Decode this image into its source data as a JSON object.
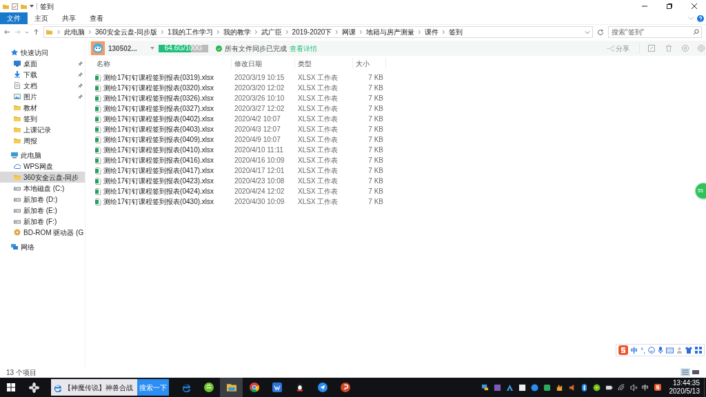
{
  "window": {
    "title": "签到"
  },
  "ribbon_tabs": [
    {
      "label": "文件",
      "selected": true
    },
    {
      "label": "主页",
      "selected": false
    },
    {
      "label": "共享",
      "selected": false
    },
    {
      "label": "查看",
      "selected": false
    }
  ],
  "breadcrumb": [
    "此电脑",
    "360安全云盘-同步版",
    "1我的工作学习",
    "我的教学",
    "武广臣",
    "2019-2020下",
    "网课",
    "地籍与房产测量",
    "课件",
    "签到"
  ],
  "search": {
    "placeholder": "搜索\"签到\""
  },
  "sidebar": [
    {
      "label": "快速访问",
      "kind": "star",
      "selected": false,
      "children": [
        {
          "label": "桌面",
          "kind": "desktop",
          "pinned": true,
          "selected": false
        },
        {
          "label": "下载",
          "kind": "download",
          "pinned": true,
          "selected": false
        },
        {
          "label": "文档",
          "kind": "document",
          "pinned": true,
          "selected": false
        },
        {
          "label": "图片",
          "kind": "image",
          "pinned": true,
          "selected": false
        },
        {
          "label": "教材",
          "kind": "folder",
          "pinned": false,
          "selected": false
        },
        {
          "label": "签到",
          "kind": "folder",
          "pinned": false,
          "selected": false
        },
        {
          "label": "上课记录",
          "kind": "folder",
          "pinned": false,
          "selected": false
        },
        {
          "label": "周报",
          "kind": "folder",
          "pinned": false,
          "selected": false
        }
      ]
    },
    {
      "label": "此电脑",
      "kind": "pc",
      "selected": false,
      "children": [
        {
          "label": "WPS网盘",
          "kind": "cloud",
          "pinned": false,
          "selected": false
        },
        {
          "label": "360安全云盘-同步",
          "kind": "folder",
          "pinned": false,
          "selected": true
        },
        {
          "label": "本地磁盘 (C:)",
          "kind": "drive",
          "pinned": false,
          "selected": false
        },
        {
          "label": "新加卷 (D:)",
          "kind": "drive",
          "pinned": false,
          "selected": false
        },
        {
          "label": "新加卷 (E:)",
          "kind": "drive",
          "pinned": false,
          "selected": false
        },
        {
          "label": "新加卷 (F:)",
          "kind": "drive",
          "pinned": false,
          "selected": false
        },
        {
          "label": "BD-ROM 驱动器 (G",
          "kind": "disc",
          "pinned": false,
          "selected": false
        }
      ]
    },
    {
      "label": "网络",
      "kind": "network",
      "selected": false
    }
  ],
  "sync_bar": {
    "account": "130502...",
    "storage": {
      "reading": "64.6G/100G",
      "level": 0.646
    },
    "status": "所有文件同步已完成",
    "details_link": "查看详情",
    "share": {
      "label": "分享",
      "disabled": true
    }
  },
  "table": {
    "columns": [
      "名称",
      "修改日期",
      "类型",
      "大小"
    ],
    "rows": [
      [
        "测绘17钉钉课程签到报表(0319).xlsx",
        "2020/3/19 10:15",
        "XLSX 工作表",
        "7 KB"
      ],
      [
        "测绘17钉钉课程签到报表(0320).xlsx",
        "2020/3/20 12:02",
        "XLSX 工作表",
        "7 KB"
      ],
      [
        "测绘17钉钉课程签到报表(0326).xlsx",
        "2020/3/26 10:10",
        "XLSX 工作表",
        "7 KB"
      ],
      [
        "测绘17钉钉课程签到报表(0327).xlsx",
        "2020/3/27 12:02",
        "XLSX 工作表",
        "7 KB"
      ],
      [
        "测绘17钉钉课程签到报表(0402).xlsx",
        "2020/4/2 10:07",
        "XLSX 工作表",
        "7 KB"
      ],
      [
        "测绘17钉钉课程签到报表(0403).xlsx",
        "2020/4/3 12:07",
        "XLSX 工作表",
        "7 KB"
      ],
      [
        "测绘17钉钉课程签到报表(0409).xlsx",
        "2020/4/9 10:07",
        "XLSX 工作表",
        "7 KB"
      ],
      [
        "测绘17钉钉课程签到报表(0410).xlsx",
        "2020/4/10 11:11",
        "XLSX 工作表",
        "7 KB"
      ],
      [
        "测绘17钉钉课程签到报表(0416).xlsx",
        "2020/4/16 10:09",
        "XLSX 工作表",
        "7 KB"
      ],
      [
        "测绘17钉钉课程签到报表(0417).xlsx",
        "2020/4/17 12:01",
        "XLSX 工作表",
        "7 KB"
      ],
      [
        "测绘17钉钉课程签到报表(0423).xlsx",
        "2020/4/23 10:08",
        "XLSX 工作表",
        "7 KB"
      ],
      [
        "测绘17钉钉课程签到报表(0424).xlsx",
        "2020/4/24 12:02",
        "XLSX 工作表",
        "7 KB"
      ],
      [
        "测绘17钉钉课程签到报表(0430).xlsx",
        "2020/4/30 10:09",
        "XLSX 工作表",
        "7 KB"
      ]
    ]
  },
  "floating_ball": "55",
  "ime_toolbar": {
    "mode": "中",
    "punct": "°,"
  },
  "status_bar": {
    "count": "13 个项目"
  },
  "taskbar": {
    "search_text": "【神魔传说】神兽合战",
    "search_button": "搜索一下",
    "ime": "中",
    "time": "13:44:35",
    "date": "2020/5/13"
  }
}
